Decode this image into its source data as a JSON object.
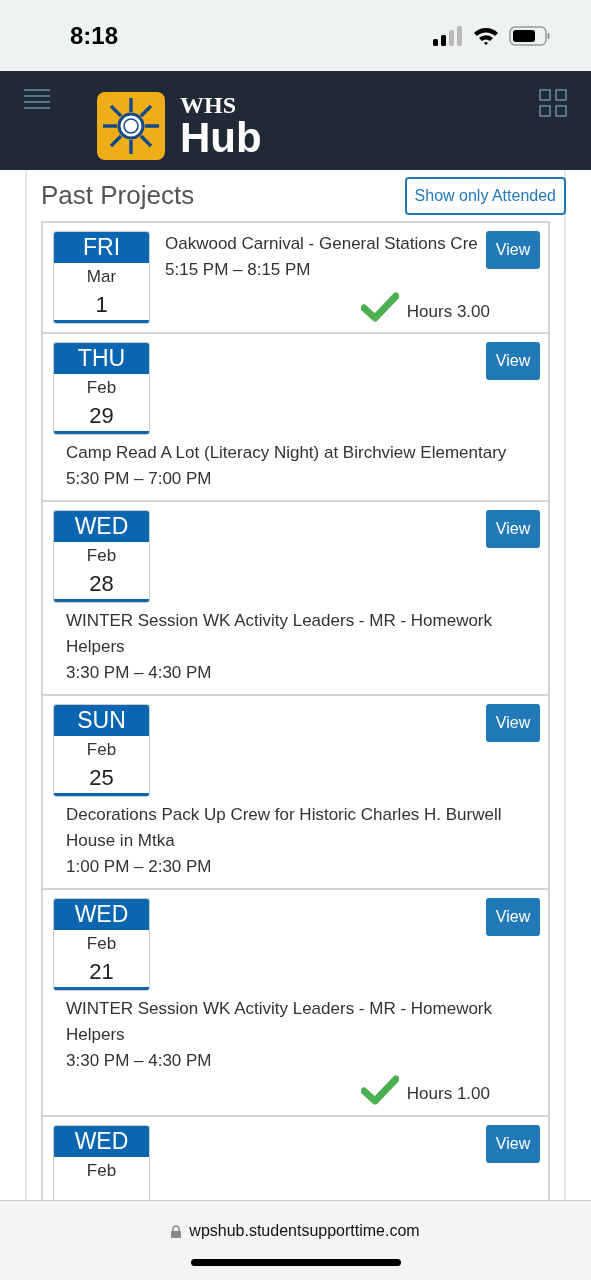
{
  "status_bar": {
    "time": "8:18"
  },
  "header": {
    "logo_small": "WHS",
    "logo_big": "Hub"
  },
  "section": {
    "title": "Past Projects",
    "filter_button": "Show only Attended"
  },
  "projects": [
    {
      "kind": "side",
      "weekday": "FRI",
      "month": "Mar",
      "day": "1",
      "title": "Oakwood Carnival - General Stations Cre",
      "time": "5:15 PM – 8:15 PM",
      "attended": true,
      "hours": "Hours 3.00",
      "button": "View"
    },
    {
      "kind": "below",
      "weekday": "THU",
      "month": "Feb",
      "day": "29",
      "title": "Camp Read A Lot (Literacy Night) at Birchview Elementary",
      "time": "5:30 PM – 7:00 PM",
      "attended": false,
      "button": "View"
    },
    {
      "kind": "below",
      "weekday": "WED",
      "month": "Feb",
      "day": "28",
      "title": "WINTER Session WK Activity Leaders - MR - Homework Helpers",
      "time": "3:30 PM – 4:30 PM",
      "attended": false,
      "button": "View"
    },
    {
      "kind": "below",
      "weekday": "SUN",
      "month": "Feb",
      "day": "25",
      "title": "Decorations Pack Up Crew for Historic Charles H. Burwell House in Mtka",
      "time": "1:00 PM – 2:30 PM",
      "attended": false,
      "button": "View"
    },
    {
      "kind": "below",
      "weekday": "WED",
      "month": "Feb",
      "day": "21",
      "title": "WINTER Session WK Activity Leaders - MR - Homework Helpers",
      "time": "3:30 PM – 4:30 PM",
      "attended": true,
      "hours": "Hours 1.00",
      "button": "View"
    },
    {
      "kind": "below",
      "weekday": "WED",
      "month": "Feb",
      "button": "View"
    }
  ],
  "browser_bar": {
    "url": "wpshub.studentsupporttime.com"
  }
}
